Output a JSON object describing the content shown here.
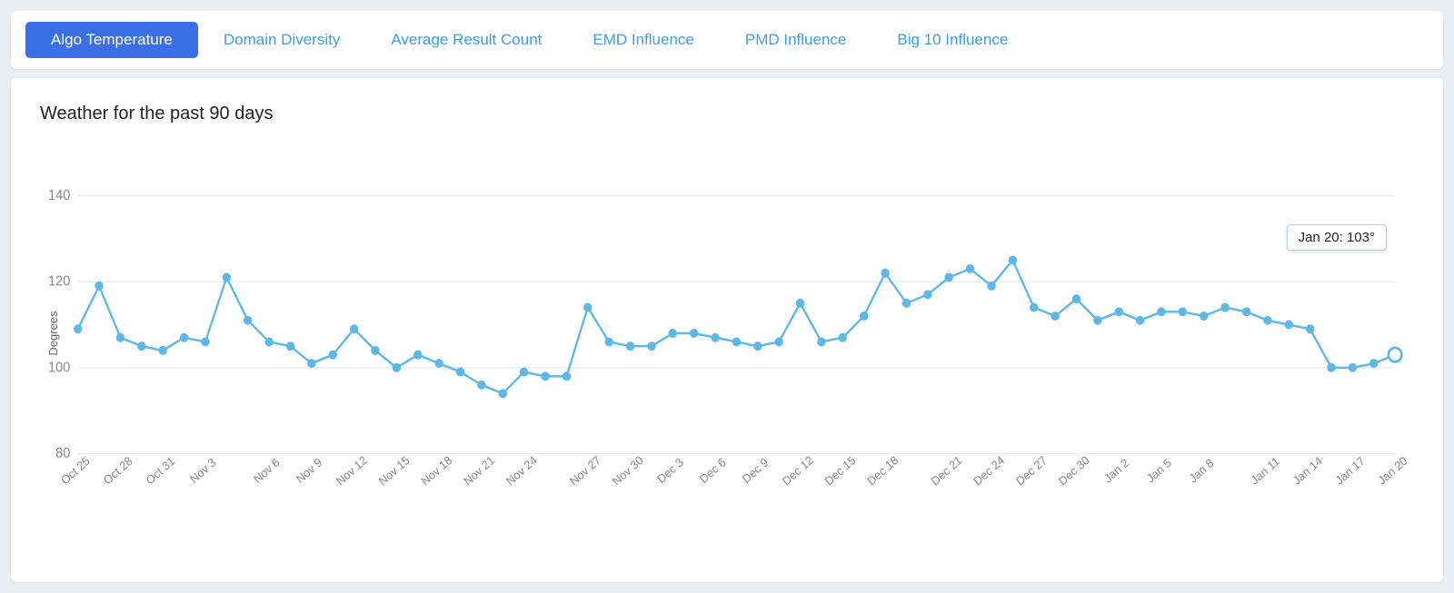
{
  "tabs": [
    {
      "id": "algo-temperature",
      "label": "Algo Temperature",
      "active": true
    },
    {
      "id": "domain-diversity",
      "label": "Domain Diversity",
      "active": false
    },
    {
      "id": "average-result-count",
      "label": "Average Result Count",
      "active": false
    },
    {
      "id": "emd-influence",
      "label": "EMD Influence",
      "active": false
    },
    {
      "id": "pmd-influence",
      "label": "PMD Influence",
      "active": false
    },
    {
      "id": "big-10-influence",
      "label": "Big 10 Influence",
      "active": false
    }
  ],
  "chart": {
    "title": "Weather for the past 90 days",
    "y_axis_label": "Degrees",
    "y_min": 80,
    "y_max": 140,
    "tooltip": "Jan 20: 103°"
  },
  "x_labels": [
    "Oct 25",
    "Oct 28",
    "Oct 31",
    "Nov 3",
    "Nov 6",
    "Nov 9",
    "Nov 12",
    "Nov 15",
    "Nov 18",
    "Nov 21",
    "Nov 24",
    "Nov 27",
    "Nov 30",
    "Dec 3",
    "Dec 6",
    "Dec 9",
    "Dec 12",
    "Dec 15",
    "Dec 18",
    "Dec 21",
    "Dec 24",
    "Dec 27",
    "Dec 30",
    "Jan 2",
    "Jan 5",
    "Jan 8",
    "Jan 11",
    "Jan 14",
    "Jan 17",
    "Jan 20"
  ],
  "y_labels": [
    "140",
    "120",
    "100",
    "80"
  ],
  "data_points": [
    109,
    119,
    107,
    105,
    104,
    107,
    106,
    121,
    111,
    106,
    105,
    101,
    103,
    109,
    104,
    100,
    103,
    101,
    99,
    96,
    94,
    99,
    98,
    98,
    114,
    106,
    105,
    105,
    108,
    108,
    107,
    106,
    105,
    106,
    115,
    106,
    107,
    112,
    122,
    115,
    117,
    121,
    123,
    119,
    125,
    114,
    112,
    116,
    111,
    113,
    111,
    113,
    113,
    112,
    114,
    113,
    111,
    110,
    109,
    100,
    100,
    101,
    103
  ]
}
